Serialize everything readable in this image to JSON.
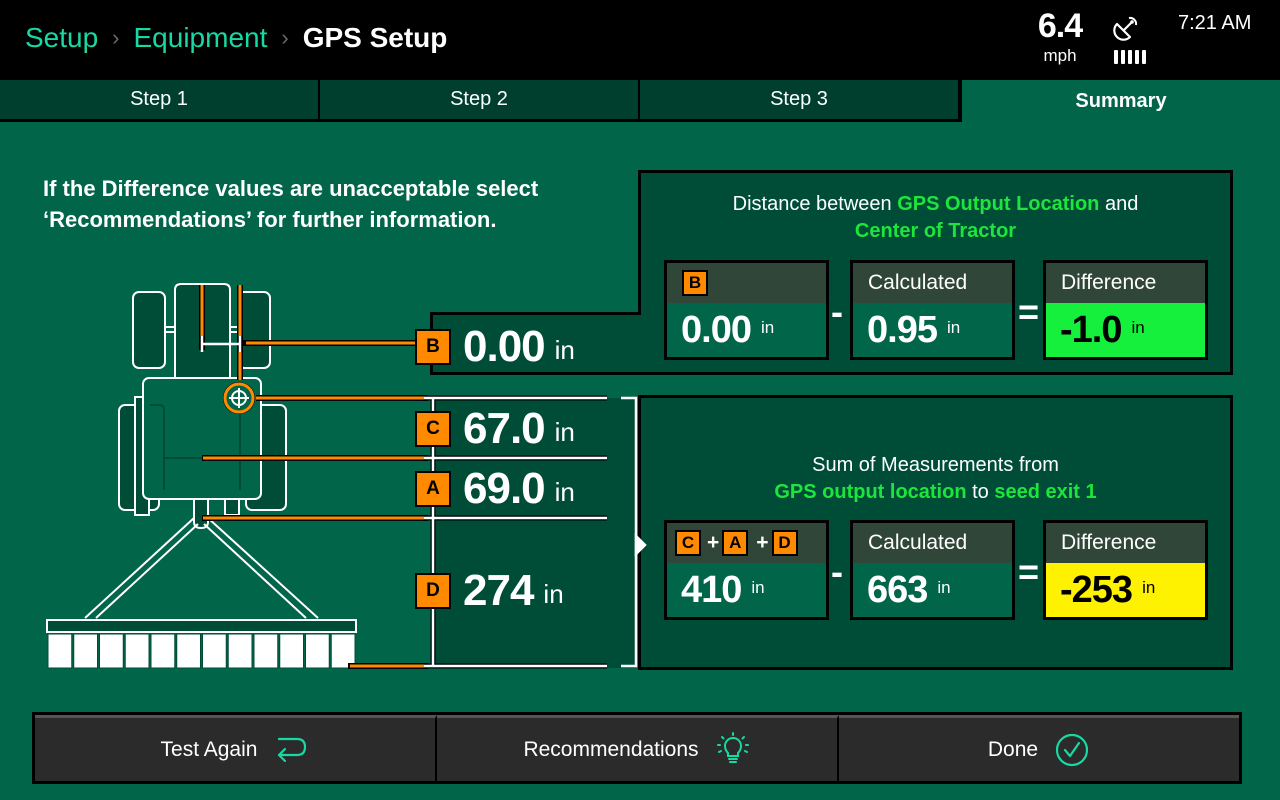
{
  "header": {
    "breadcrumb": [
      {
        "label": "Setup"
      },
      {
        "label": "Equipment"
      }
    ],
    "breadcrumb_separator": "›",
    "title": "GPS Setup",
    "speed": {
      "value": "6.4",
      "unit": "mph"
    },
    "gps_icon": "satellite-dish-icon",
    "signal_bars": 5,
    "time": "7:21 AM"
  },
  "tabs": [
    {
      "label": "Step 1",
      "active": false
    },
    {
      "label": "Step 2",
      "active": false
    },
    {
      "label": "Step 3",
      "active": false
    },
    {
      "label": "Summary",
      "active": true
    }
  ],
  "instruction": "If the Difference values are unacceptable select ‘Recommendations’ for further information.",
  "diagram": {
    "measurements": [
      {
        "tag": "B",
        "value": "0.00",
        "unit": "in"
      },
      {
        "tag": "C",
        "value": "67.0",
        "unit": "in"
      },
      {
        "tag": "A",
        "value": "69.0",
        "unit": "in"
      },
      {
        "tag": "D",
        "value": "274",
        "unit": "in"
      }
    ],
    "colors": {
      "marker": "#ff8a00",
      "outline": "#ffffff",
      "body": "#004d37"
    }
  },
  "panel_top": {
    "caption_pre": "Distance between ",
    "caption_hl1": "GPS Output Location",
    "caption_mid": " and",
    "caption_hl2": "Center of Tractor",
    "measured": {
      "tag": "B",
      "value": "0.00",
      "unit": "in"
    },
    "minus": "-",
    "calculated": {
      "label": "Calculated",
      "value": "0.95",
      "unit": "in"
    },
    "equals": "=",
    "difference": {
      "label": "Difference",
      "value": "-1.0",
      "unit": "in",
      "status_color": "#14f03c"
    }
  },
  "panel_bottom": {
    "caption_line1": "Sum of Measurements from",
    "caption_hl1": "GPS output location",
    "caption_mid": " to ",
    "caption_hl2": "seed exit 1",
    "measured": {
      "tags": [
        "C",
        "A",
        "D"
      ],
      "plus": "+",
      "value": "410",
      "unit": "in"
    },
    "minus": "-",
    "calculated": {
      "label": "Calculated",
      "value": "663",
      "unit": "in"
    },
    "equals": "=",
    "difference": {
      "label": "Difference",
      "value": "-253",
      "unit": "in",
      "status_color": "#fff200"
    }
  },
  "footer": {
    "buttons": [
      {
        "label": "Test Again",
        "icon": "return-arrow-icon"
      },
      {
        "label": "Recommendations",
        "icon": "lightbulb-icon"
      },
      {
        "label": "Done",
        "icon": "check-circle-icon"
      }
    ],
    "icon_color": "#17d9a3"
  }
}
